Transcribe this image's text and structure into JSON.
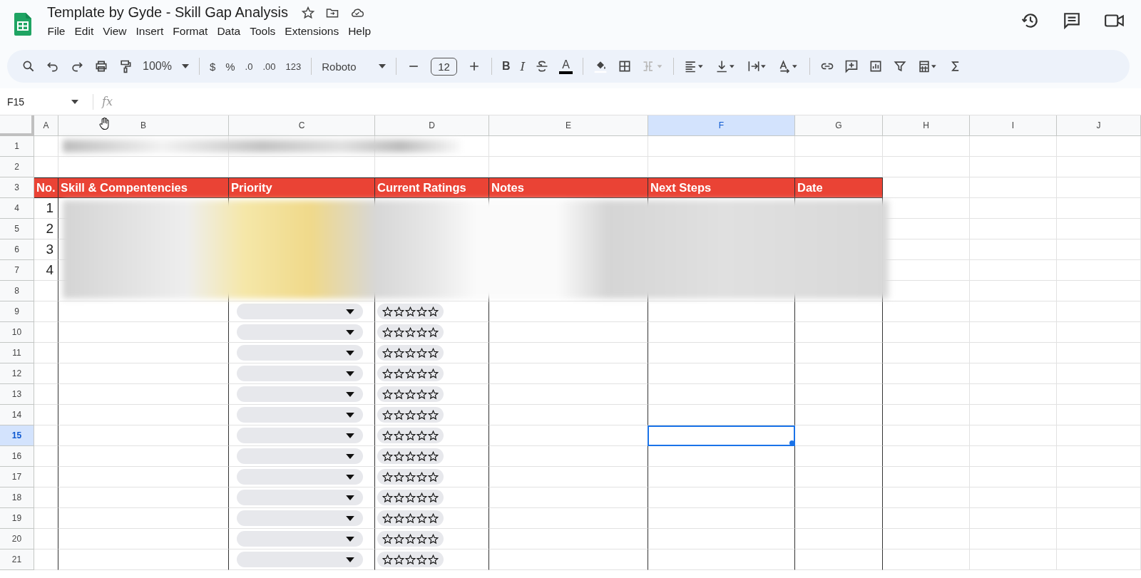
{
  "document": {
    "title": "Template by Gyde - Skill Gap Analysis"
  },
  "menu": [
    "File",
    "Edit",
    "View",
    "Insert",
    "Format",
    "Data",
    "Tools",
    "Extensions",
    "Help"
  ],
  "toolbar": {
    "zoom": "100%",
    "currency": "$",
    "percent": "%",
    "decrease_decimal": ".0",
    "increase_decimal": ".00",
    "number_format": "123",
    "font": "Roboto",
    "font_size": "12",
    "bold": "B",
    "italic": "I",
    "text_color": "A"
  },
  "formula_bar": {
    "cell_ref": "F15",
    "fx": "fx"
  },
  "columns": [
    {
      "label": "A",
      "selected": false
    },
    {
      "label": "B",
      "selected": false
    },
    {
      "label": "C",
      "selected": false
    },
    {
      "label": "D",
      "selected": false
    },
    {
      "label": "E",
      "selected": false
    },
    {
      "label": "F",
      "selected": true
    },
    {
      "label": "G",
      "selected": false
    },
    {
      "label": "H",
      "selected": false
    },
    {
      "label": "I",
      "selected": false
    },
    {
      "label": "J",
      "selected": false
    }
  ],
  "header_row": [
    "No.",
    "Skill & Compentencies",
    "Priority",
    "Current Ratings",
    "Notes",
    "Next Steps",
    "Date"
  ],
  "rows": [
    {
      "number": "1",
      "selected": false,
      "kind": "title"
    },
    {
      "number": "2",
      "selected": false,
      "kind": "empty"
    },
    {
      "number": "3",
      "selected": false,
      "kind": "header"
    },
    {
      "number": "4",
      "selected": false,
      "kind": "record",
      "no": "1"
    },
    {
      "number": "5",
      "selected": false,
      "kind": "record",
      "no": "2"
    },
    {
      "number": "6",
      "selected": false,
      "kind": "record",
      "no": "3"
    },
    {
      "number": "7",
      "selected": false,
      "kind": "record",
      "no": "4"
    },
    {
      "number": "8",
      "selected": false,
      "kind": "record"
    },
    {
      "number": "9",
      "selected": false,
      "kind": "entry",
      "stars": 0
    },
    {
      "number": "10",
      "selected": false,
      "kind": "entry",
      "stars": 0
    },
    {
      "number": "11",
      "selected": false,
      "kind": "entry",
      "stars": 0
    },
    {
      "number": "12",
      "selected": false,
      "kind": "entry",
      "stars": 0
    },
    {
      "number": "13",
      "selected": false,
      "kind": "entry",
      "stars": 0
    },
    {
      "number": "14",
      "selected": false,
      "kind": "entry",
      "stars": 0
    },
    {
      "number": "15",
      "selected": true,
      "kind": "entry",
      "stars": 0
    },
    {
      "number": "16",
      "selected": false,
      "kind": "entry",
      "stars": 0
    },
    {
      "number": "17",
      "selected": false,
      "kind": "entry",
      "stars": 0
    },
    {
      "number": "18",
      "selected": false,
      "kind": "entry",
      "stars": 0
    },
    {
      "number": "19",
      "selected": false,
      "kind": "entry",
      "stars": 0
    },
    {
      "number": "20",
      "selected": false,
      "kind": "entry",
      "stars": 0
    },
    {
      "number": "21",
      "selected": false,
      "kind": "entry",
      "stars": 0
    }
  ]
}
